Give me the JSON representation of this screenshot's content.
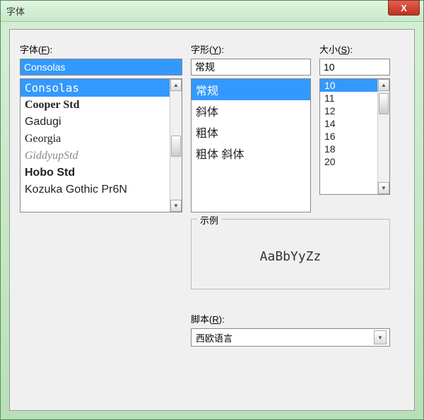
{
  "titlebar": {
    "title": "字体"
  },
  "font": {
    "label": "字体(F):",
    "value": "Consolas",
    "items": [
      "Consolas",
      "Cooper Std",
      "Gadugi",
      "Georgia",
      "GiddyupStd",
      "Hobo Std",
      "Kozuka Gothic Pr6N"
    ],
    "selectedIndex": 0
  },
  "style": {
    "label": "字形(Y):",
    "value": "常规",
    "items": [
      "常规",
      "斜体",
      "粗体",
      "粗体 斜体"
    ],
    "selectedIndex": 0
  },
  "size": {
    "label": "大小(S):",
    "value": "10",
    "items": [
      "10",
      "11",
      "12",
      "14",
      "16",
      "18",
      "20"
    ],
    "selectedIndex": 0
  },
  "sample": {
    "label": "示例",
    "text": "AaBbYyZz"
  },
  "script": {
    "label": "脚本(R):",
    "value": "西欧语言"
  },
  "buttons": {
    "close": "X"
  },
  "fontClasses": [
    "font-consolas",
    "font-cooper",
    "font-gadugi",
    "font-georgia",
    "font-giddy",
    "font-hobo",
    "font-kozuka"
  ]
}
